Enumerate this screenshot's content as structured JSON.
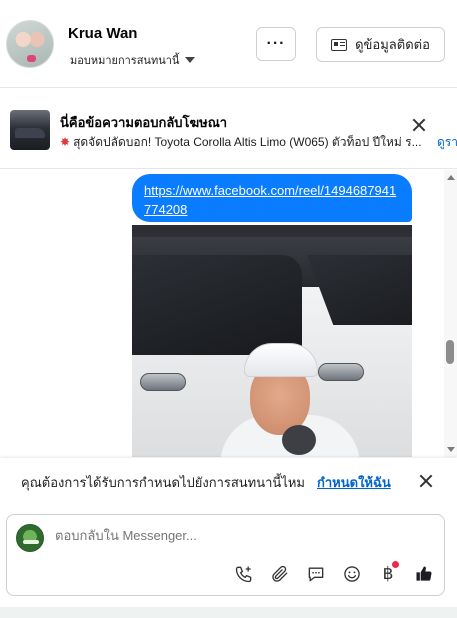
{
  "header": {
    "contact_name": "Krua Wan",
    "assign_label": "มอบหมายการสนทนานี้",
    "more_label": "···",
    "contact_info_label": "ดูข้อมูลติดต่อ"
  },
  "ad_reply": {
    "title": "นี่คือข้อความตอบกลับโฆษณา",
    "subtitle": "สุดจัดปลัดบอก! Toyota Corolla Altis Limo (W065) ตัวท็อป ปีใหม่ ร...",
    "link_text": "ดูรา"
  },
  "thread": {
    "message_link": "https://www.facebook.com/reel/1494687941774208"
  },
  "notice": {
    "text": "คุณต้องการได้รับการกำหนดไปยังการสนทนานี้ไหม",
    "action_label": "กำหนดให้ฉัน"
  },
  "composer": {
    "placeholder": "ตอบกลับใน Messenger...",
    "tools": [
      "call-plus-icon",
      "paperclip-icon",
      "chat-bubble-icon",
      "smile-icon",
      "baht-icon",
      "thumbs-up-icon"
    ],
    "baht_glyph": "฿"
  },
  "colors": {
    "accent": "#0a7cff",
    "link": "#0064d1",
    "badge": "#f0284a"
  }
}
